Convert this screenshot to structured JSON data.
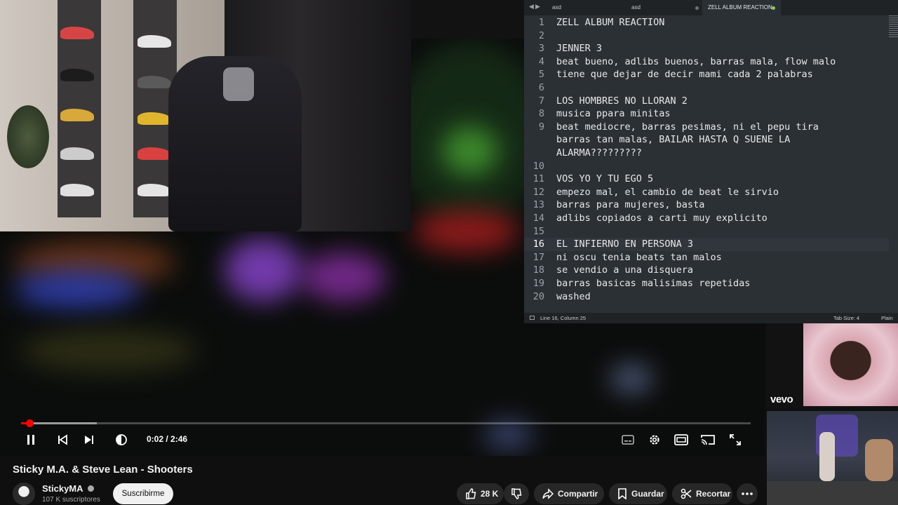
{
  "editor": {
    "tabs": [
      {
        "label": "asd",
        "active": false
      },
      {
        "label": "asd",
        "active": false
      },
      {
        "label": "ZELL ALBUM REACTION",
        "active": true
      }
    ],
    "lines": [
      {
        "n": "1",
        "text": "ZELL ALBUM REACTION"
      },
      {
        "n": "2",
        "text": ""
      },
      {
        "n": "3",
        "text": "JENNER 3"
      },
      {
        "n": "4",
        "text": "beat bueno, adlibs buenos, barras mala, flow malo"
      },
      {
        "n": "5",
        "text": "tiene que dejar de decir mami cada 2 palabras"
      },
      {
        "n": "6",
        "text": ""
      },
      {
        "n": "7",
        "text": "LOS HOMBRES NO LLORAN 2"
      },
      {
        "n": "8",
        "text": "musica ppara minitas"
      },
      {
        "n": "9",
        "text": "beat mediocre, barras pesimas, ni el pepu tira"
      },
      {
        "n": "",
        "text": "barras tan malas, BAILAR HASTA Q SUENE LA"
      },
      {
        "n": "",
        "text": "ALARMA?????????"
      },
      {
        "n": "10",
        "text": ""
      },
      {
        "n": "11",
        "text": "VOS YO Y TU EGO 5"
      },
      {
        "n": "12",
        "text": "empezo mal, el cambio de beat le sirvio"
      },
      {
        "n": "13",
        "text": "barras para mujeres, basta"
      },
      {
        "n": "14",
        "text": "adlibs copiados a carti muy explicito"
      },
      {
        "n": "15",
        "text": ""
      },
      {
        "n": "16",
        "text": "EL INFIERNO EN PERSONA 3",
        "current": true
      },
      {
        "n": "17",
        "text": "ni oscu tenia beats tan malos"
      },
      {
        "n": "18",
        "text": "se vendio a una disquera"
      },
      {
        "n": "19",
        "text": "barras basicas malisimas repetidas"
      },
      {
        "n": "20",
        "text": "washed"
      }
    ],
    "status": {
      "position": "Line 16, Column 25",
      "tab_size": "Tab Size: 4",
      "syntax": "Plain Te"
    }
  },
  "player": {
    "time": "0:02 / 2:46",
    "progress_fraction": 0.012,
    "buffer_fraction": 0.104,
    "controls": [
      "pause-icon",
      "previous-icon",
      "next-icon",
      "volume-icon",
      "subtitles-icon",
      "settings-icon",
      "theater-icon",
      "cast-icon",
      "fullscreen-icon"
    ]
  },
  "video": {
    "title": "Sticky M.A. & Steve Lean - Shooters",
    "channel": "StickyMA",
    "subscribers": "107 K suscriptores",
    "subscribe_label": "Suscribirme",
    "likes": "28 K",
    "share_label": "Compartir",
    "save_label": "Guardar",
    "clip_label": "Recortar"
  },
  "sidebar": {
    "vevo_label": "vevo"
  },
  "colors": {
    "accent": "#ff0000",
    "editor_bg": "#2b3035",
    "tab_dot_active": "#8fc866",
    "tab_dot": "#6d7378"
  }
}
